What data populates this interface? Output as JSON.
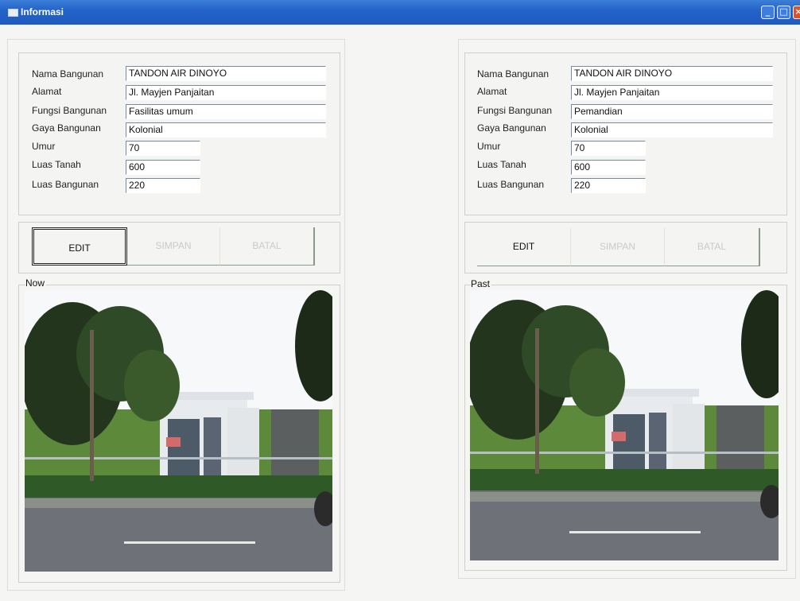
{
  "window": {
    "title": "Informasi"
  },
  "left": {
    "fields": [
      {
        "label": "Nama Bangunan",
        "value": "TANDON AIR DINOYO"
      },
      {
        "label": "Alamat",
        "value": "Jl. Mayjen Panjaitan"
      },
      {
        "label": "Fungsi Bangunan",
        "value": "Fasilitas umum"
      },
      {
        "label": "Gaya Bangunan",
        "value": "Kolonial"
      },
      {
        "label": "Umur",
        "value": "70"
      },
      {
        "label": "Luas Tanah",
        "value": "600"
      },
      {
        "label": "Luas Bangunan",
        "value": "220"
      }
    ],
    "buttons": {
      "edit": "EDIT",
      "save": "SIMPAN",
      "cancel": "BATAL"
    },
    "photo_caption": "Now"
  },
  "right": {
    "fields": [
      {
        "label": "Nama Bangunan",
        "value": "TANDON AIR DINOYO"
      },
      {
        "label": "Alamat",
        "value": "Jl. Mayjen Panjaitan"
      },
      {
        "label": "Fungsi Bangunan",
        "value": "Pemandian"
      },
      {
        "label": "Gaya Bangunan",
        "value": "Kolonial"
      },
      {
        "label": "Umur",
        "value": "70"
      },
      {
        "label": "Luas Tanah",
        "value": "600"
      },
      {
        "label": "Luas Bangunan",
        "value": "220"
      }
    ],
    "buttons": {
      "edit": "EDIT",
      "save": "SIMPAN",
      "cancel": "BATAL"
    },
    "photo_caption": "Past"
  },
  "colors": {
    "titlebar": "#2463c9",
    "window_bg": "#f5f6f3"
  }
}
